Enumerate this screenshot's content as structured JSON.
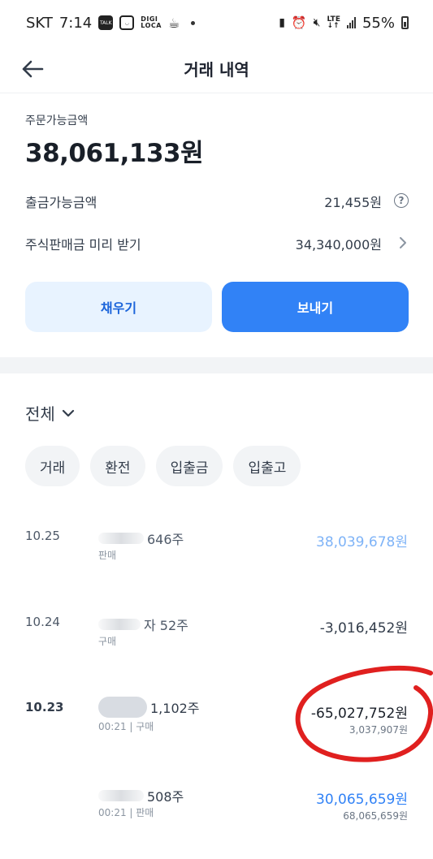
{
  "status_bar": {
    "carrier": "SKT",
    "time": "7:14",
    "talk_badge": "TALK",
    "digiloca_top": "DIGI",
    "digiloca_bottom": "LOCA",
    "lte_top": "LTE",
    "lte_bottom": "↓↑",
    "battery": "55%"
  },
  "header": {
    "title": "거래 내역"
  },
  "summary": {
    "order_label": "주문가능금액",
    "order_amount": "38,061,133원",
    "withdraw_label": "출금가능금액",
    "withdraw_amount": "21,455원",
    "presale_label": "주식판매금 미리 받기",
    "presale_amount": "34,340,000원"
  },
  "actions": {
    "fill_label": "채우기",
    "send_label": "보내기"
  },
  "filter": {
    "selected": "전체",
    "chips": [
      "거래",
      "환전",
      "입출금",
      "입출고"
    ]
  },
  "transactions": [
    {
      "date": "10.25",
      "name": "646주",
      "sub": "판매",
      "amount": "38,039,678원",
      "sub_amount": ""
    },
    {
      "date": "10.24",
      "name": "자 52주",
      "sub": "구매",
      "amount": "-3,016,452원",
      "sub_amount": ""
    },
    {
      "date": "10.23",
      "name": "1,102주",
      "sub": "00:21 | 구매",
      "amount": "-65,027,752원",
      "sub_amount": "3,037,907원"
    },
    {
      "date": "",
      "name": "508주",
      "sub": "00:21 | 판매",
      "amount": "30,065,659원",
      "sub_amount": "68,065,659원"
    }
  ],
  "colors": {
    "accent": "#3182f6",
    "accent_light": "#e8f3ff",
    "sell_faded": "#7eb3f7",
    "annotation": "#e0201f"
  }
}
